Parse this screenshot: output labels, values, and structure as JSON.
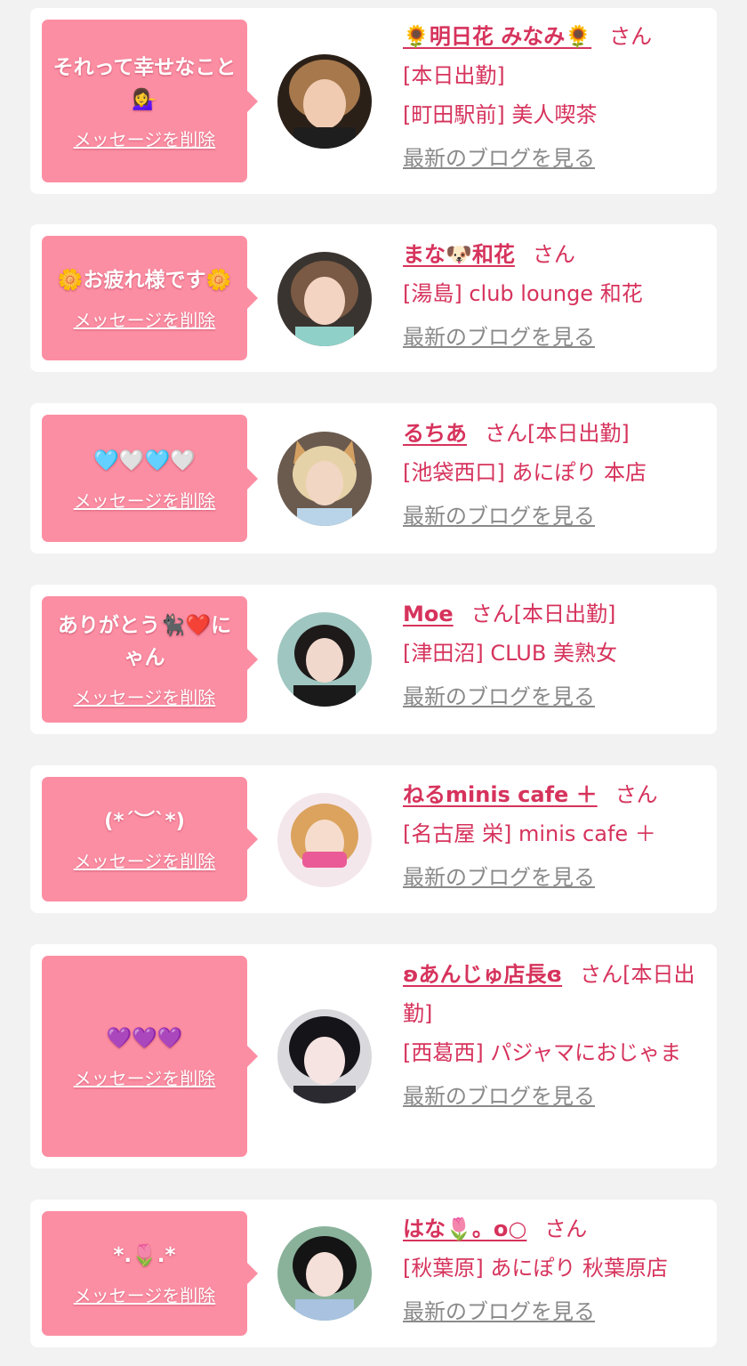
{
  "delete_label": "メッセージを削除",
  "blog_label": "最新のブログを見る",
  "san_label": "さん",
  "colors": {
    "bubble": "#fc8ea3",
    "accent": "#d6335c",
    "link_gray": "#8a8a8a",
    "background": "#f2f2f2"
  },
  "cards": [
    {
      "message": "それって幸せなこと💁‍♀️",
      "name": "🌻明日花 みなみ🌻",
      "attendance": "[本日出勤]",
      "location": "[町田駅前] 美人喫茶"
    },
    {
      "message": "🌼お疲れ様です🌼",
      "name": "まな🐶和花",
      "attendance": "",
      "location": "[湯島] club lounge 和花"
    },
    {
      "message": "🩵🤍🩵🤍",
      "name": "るちあ",
      "attendance": "[本日出勤]",
      "location": "[池袋西口] あにぽり 本店"
    },
    {
      "message": "ありがとう🐈‍⬛❤️にゃん",
      "name": "Moe",
      "attendance": "[本日出勤]",
      "location": "[津田沼] CLUB 美熟女"
    },
    {
      "message": "(*´︶`*)",
      "name": "ねるminis cafe ＋",
      "attendance": "",
      "location": "[名古屋 栄] minis cafe ＋"
    },
    {
      "message": "💜💜💜",
      "name": "ʚあんじゅ店長ɞ",
      "attendance": "[本日出勤]",
      "location": "[西葛西] パジャマにおじゃま"
    },
    {
      "message": "*.🌷.*",
      "name": "はな🌷。o○",
      "attendance": "",
      "location": "[秋葉原] あにぽり 秋葉原店"
    }
  ]
}
